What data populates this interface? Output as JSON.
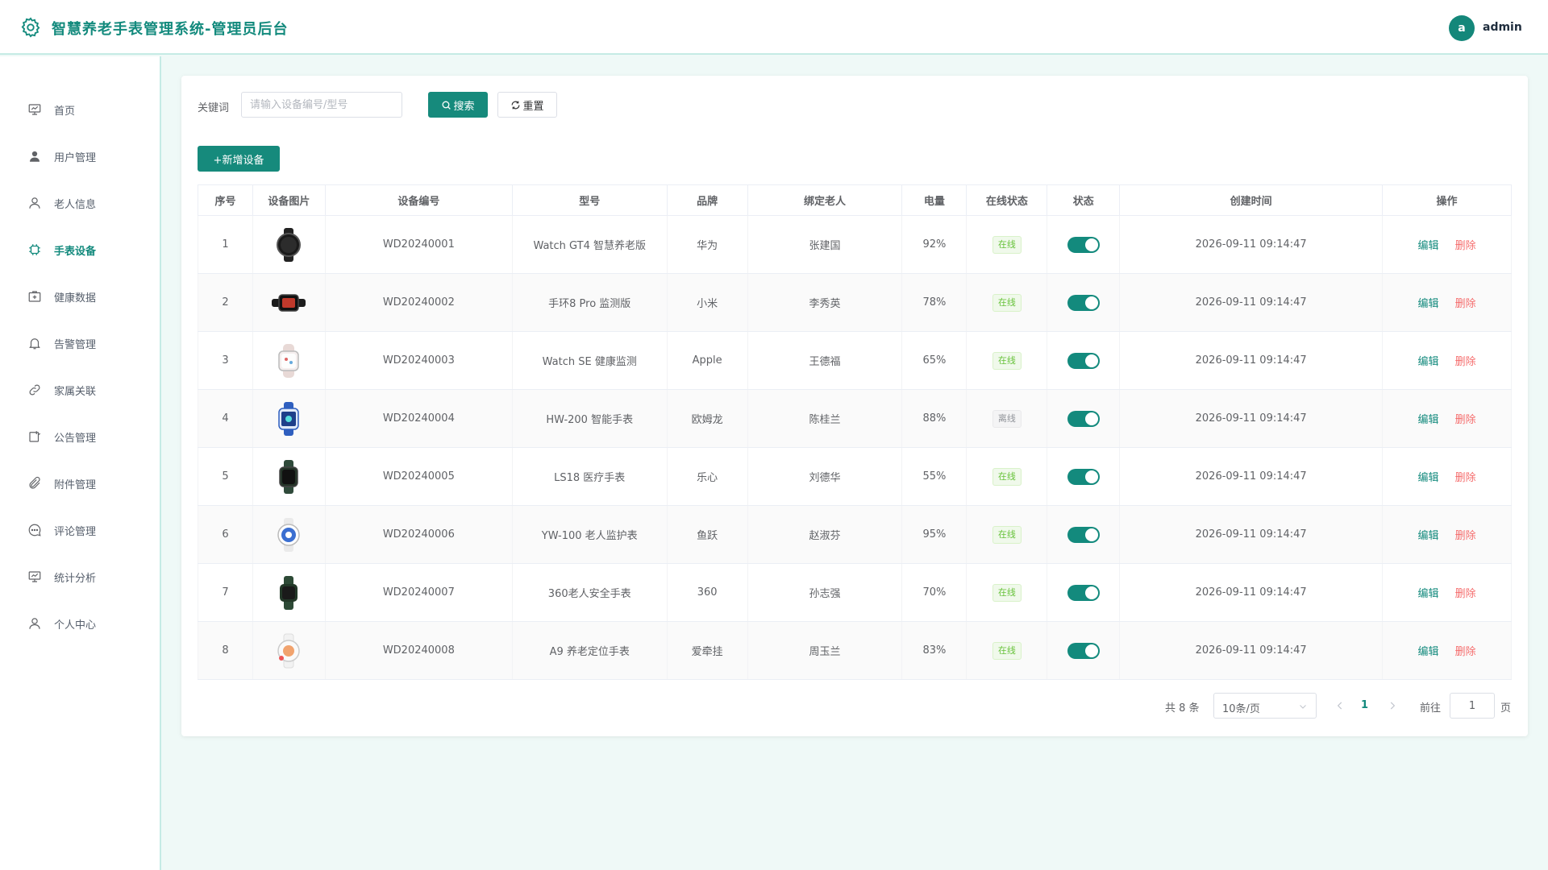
{
  "header": {
    "title": "智慧养老手表管理系统-管理员后台",
    "avatar_letter": "a",
    "username": "admin"
  },
  "sidebar": {
    "items": [
      {
        "label": "首页",
        "icon": "dashboard-icon",
        "active": false
      },
      {
        "label": "用户管理",
        "icon": "user-filled-icon",
        "active": false
      },
      {
        "label": "老人信息",
        "icon": "user-icon",
        "active": false
      },
      {
        "label": "手表设备",
        "icon": "device-icon",
        "active": true
      },
      {
        "label": "健康数据",
        "icon": "first-aid-icon",
        "active": false
      },
      {
        "label": "告警管理",
        "icon": "bell-icon",
        "active": false
      },
      {
        "label": "家属关联",
        "icon": "link-icon",
        "active": false
      },
      {
        "label": "公告管理",
        "icon": "notice-icon",
        "active": false
      },
      {
        "label": "附件管理",
        "icon": "paperclip-icon",
        "active": false
      },
      {
        "label": "评论管理",
        "icon": "comment-icon",
        "active": false
      },
      {
        "label": "统计分析",
        "icon": "chart-icon",
        "active": false
      },
      {
        "label": "个人中心",
        "icon": "profile-icon",
        "active": false
      }
    ]
  },
  "search": {
    "label": "关键词",
    "placeholder": "请输入设备编号/型号",
    "search_button": "搜索",
    "reset_button": "重置"
  },
  "toolbar": {
    "add_button": "+新增设备"
  },
  "table": {
    "columns": [
      "序号",
      "设备图片",
      "设备编号",
      "型号",
      "品牌",
      "绑定老人",
      "电量",
      "在线状态",
      "状态",
      "创建时间",
      "操作"
    ],
    "rows": [
      {
        "index": "1",
        "code": "WD20240001",
        "model": "Watch GT4 智慧养老版",
        "brand": "华为",
        "elder": "张建国",
        "battery": "92%",
        "online": "在线",
        "status_on": true,
        "created": "2026-09-11 09:14:47"
      },
      {
        "index": "2",
        "code": "WD20240002",
        "model": "手环8 Pro 监测版",
        "brand": "小米",
        "elder": "李秀英",
        "battery": "78%",
        "online": "在线",
        "status_on": true,
        "created": "2026-09-11 09:14:47"
      },
      {
        "index": "3",
        "code": "WD20240003",
        "model": "Watch SE 健康监测",
        "brand": "Apple",
        "elder": "王德福",
        "battery": "65%",
        "online": "在线",
        "status_on": true,
        "created": "2026-09-11 09:14:47"
      },
      {
        "index": "4",
        "code": "WD20240004",
        "model": "HW-200 智能手表",
        "brand": "欧姆龙",
        "elder": "陈桂兰",
        "battery": "88%",
        "online": "离线",
        "status_on": true,
        "created": "2026-09-11 09:14:47"
      },
      {
        "index": "5",
        "code": "WD20240005",
        "model": "LS18 医疗手表",
        "brand": "乐心",
        "elder": "刘德华",
        "battery": "55%",
        "online": "在线",
        "status_on": true,
        "created": "2026-09-11 09:14:47"
      },
      {
        "index": "6",
        "code": "WD20240006",
        "model": "YW-100 老人监护表",
        "brand": "鱼跃",
        "elder": "赵淑芬",
        "battery": "95%",
        "online": "在线",
        "status_on": true,
        "created": "2026-09-11 09:14:47"
      },
      {
        "index": "7",
        "code": "WD20240007",
        "model": "360老人安全手表",
        "brand": "360",
        "elder": "孙志强",
        "battery": "70%",
        "online": "在线",
        "status_on": true,
        "created": "2026-09-11 09:14:47"
      },
      {
        "index": "8",
        "code": "WD20240008",
        "model": "A9 养老定位手表",
        "brand": "爱牵挂",
        "elder": "周玉兰",
        "battery": "83%",
        "online": "在线",
        "status_on": true,
        "created": "2026-09-11 09:14:47"
      }
    ],
    "actions": {
      "edit": "编辑",
      "delete": "删除"
    }
  },
  "pagination": {
    "total": "共 8 条",
    "page_size": "10条/页",
    "current_page": "1",
    "goto_label": "前往",
    "goto_value": "1",
    "page_unit": "页"
  },
  "colors": {
    "primary": "#168a7c",
    "danger": "#f56c6c",
    "online": "#67c23a"
  }
}
